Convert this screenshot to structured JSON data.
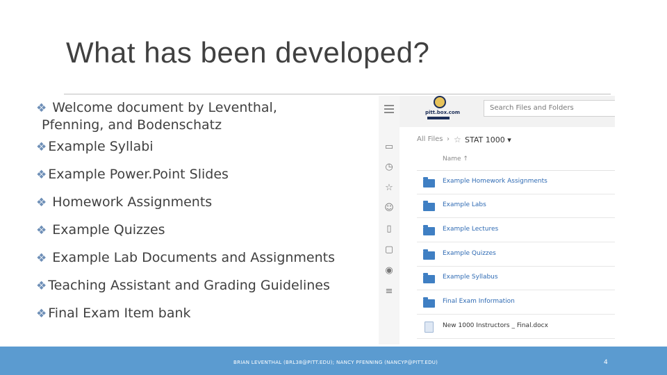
{
  "slide": {
    "title": "What has been developed?",
    "bullet_marker": "❖",
    "bullets": [
      {
        "line1": "Welcome document  by Leventhal,",
        "line2": "Pfenning, and Bodenschatz"
      },
      {
        "line1": "Example Syllabi"
      },
      {
        "line1": "Example Power.Point Slides"
      },
      {
        "line1": "Homework Assignments"
      },
      {
        "line1": "Example Quizzes"
      },
      {
        "line1": "Example Lab Documents and Assignments"
      },
      {
        "line1": "Teaching Assistant and Grading Guidelines"
      },
      {
        "line1": "Final Exam Item bank"
      }
    ]
  },
  "screenshot": {
    "logo_text": "pitt.box.com",
    "search_placeholder": "Search Files and Folders",
    "breadcrumb_root": "All Files",
    "breadcrumb_sep": "›",
    "breadcrumb_folder": "STAT 1000 ▾",
    "name_header": "Name ↑",
    "files": [
      {
        "name": "Example Homework Assignments",
        "type": "folder"
      },
      {
        "name": "Example Labs",
        "type": "folder"
      },
      {
        "name": "Example Lectures",
        "type": "folder"
      },
      {
        "name": "Example Quizzes",
        "type": "folder"
      },
      {
        "name": "Example Syllabus",
        "type": "folder"
      },
      {
        "name": "Final Exam Information",
        "type": "folder"
      },
      {
        "name": "New 1000 Instructors _ Final.docx",
        "type": "document"
      }
    ],
    "sidebar_icons": [
      "files-icon",
      "recents-icon",
      "favorites-icon",
      "synced-icon",
      "trash-icon",
      "notes-icon",
      "relay-icon",
      "tasks-icon"
    ]
  },
  "footer": {
    "credit": "BRIAN LEVENTHAL (BRL38@PITT.EDU); NANCY PFENNING (NANCYP@PITT.EDU)",
    "page_number": "4"
  },
  "colors": {
    "accent": "#5b9bd0",
    "bullet": "#6e8fb7",
    "text": "#404040",
    "folder": "#3f7fc3"
  }
}
